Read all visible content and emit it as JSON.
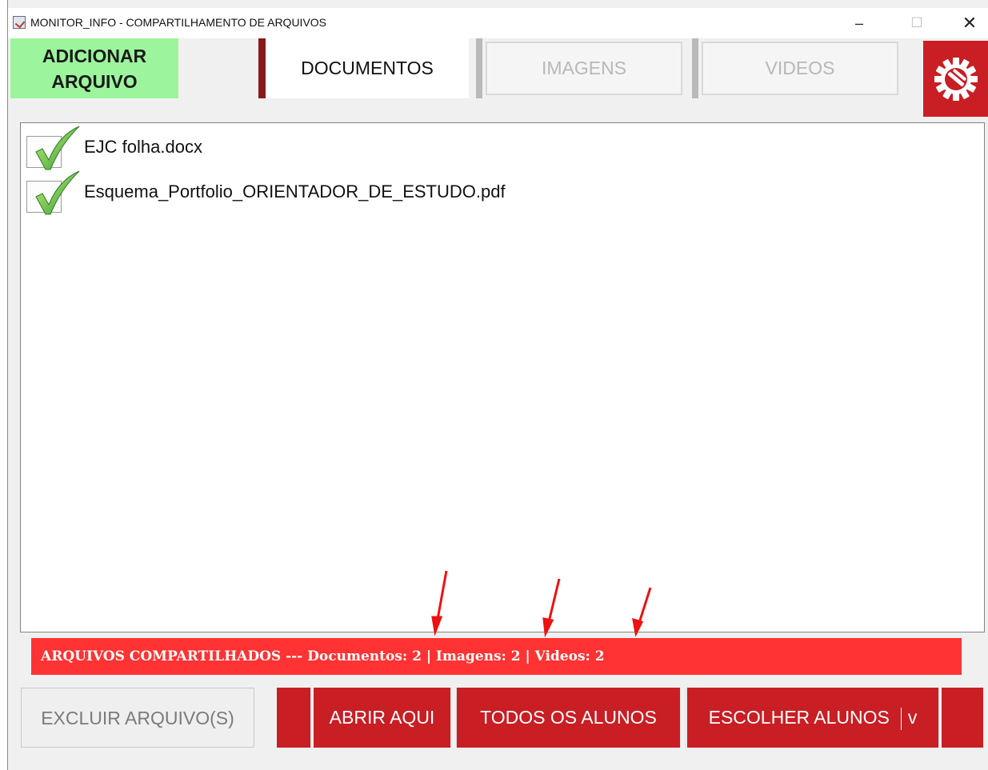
{
  "window": {
    "title": "MONITOR_INFO - COMPARTILHAMENTO DE ARQUIVOS",
    "minimize": "–",
    "maximize": "☐",
    "close": "✕"
  },
  "toolbar": {
    "add_line1": "ADICIONAR",
    "add_line2": "ARQUIVO",
    "tabs": [
      {
        "label": "DOCUMENTOS",
        "active": true
      },
      {
        "label": "IMAGENS",
        "active": false
      },
      {
        "label": "VIDEOS",
        "active": false
      }
    ],
    "settings_icon": "gear-wrench-icon"
  },
  "files": [
    {
      "name": "EJC folha.docx",
      "checked": true
    },
    {
      "name": "Esquema_Portfolio_ORIENTADOR_DE_ESTUDO.pdf",
      "checked": true
    }
  ],
  "status": {
    "text": "ARQUIVOS COMPARTILHADOS --- Documentos: 2 | Imagens: 2 | Videos: 2",
    "documentos": 2,
    "imagens": 2,
    "videos": 2
  },
  "buttons": {
    "delete": "EXCLUIR ARQUIVO(S)",
    "open_here": "ABRIR AQUI",
    "all_students": "TODOS OS ALUNOS",
    "choose_students": "ESCOLHER ALUNOS",
    "dropdown_arrow": "v"
  },
  "colors": {
    "accent_red": "#c81e24",
    "status_red": "#ff3333",
    "add_green": "#9cf59c",
    "active_tab_marker": "#8b1a1a"
  }
}
